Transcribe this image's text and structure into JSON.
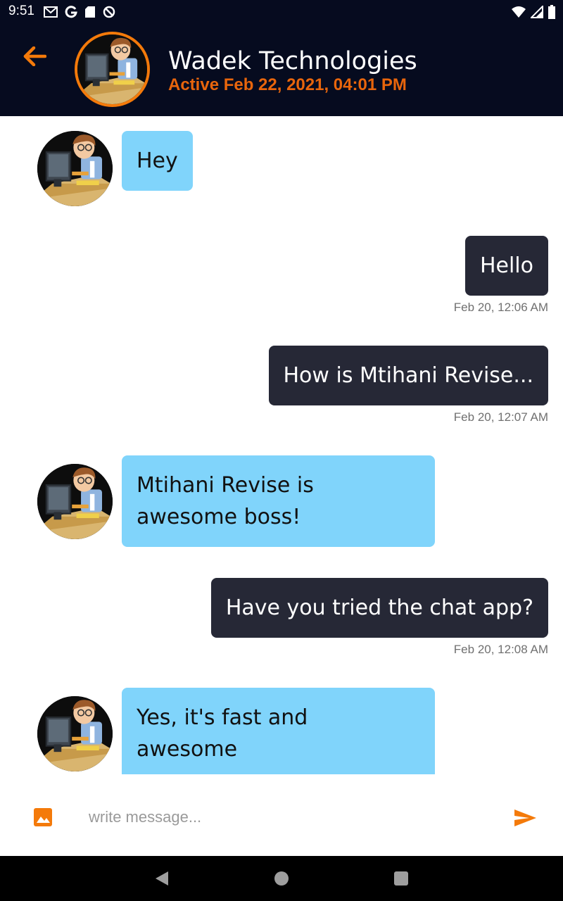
{
  "status_bar": {
    "time": "9:51",
    "left_icons": [
      "gmail-icon",
      "google-icon",
      "sd-card-icon",
      "no-disturb-icon"
    ],
    "right_icons": [
      "wifi-icon",
      "signal-icon",
      "battery-icon"
    ]
  },
  "header": {
    "back_icon": "arrow-back-icon",
    "contact_name": "Wadek Technologies",
    "status": "Active Feb 22, 2021, 04:01 PM"
  },
  "messages": [
    {
      "direction": "incoming",
      "text": "Hey"
    },
    {
      "direction": "outgoing",
      "text": "Hello",
      "time": "Feb 20, 12:06 AM"
    },
    {
      "direction": "outgoing",
      "text": "How is Mtihani Revise...",
      "time": "Feb 20, 12:07 AM"
    },
    {
      "direction": "incoming",
      "text_lines": [
        "Mtihani Revise is",
        "awesome boss!"
      ]
    },
    {
      "direction": "outgoing",
      "text": "Have you tried the chat app?",
      "time": "Feb 20, 12:08 AM"
    },
    {
      "direction": "incoming",
      "text_lines": [
        "Yes, it's fast and",
        "awesome"
      ]
    }
  ],
  "composer": {
    "placeholder": "write message...",
    "value": "",
    "attach_icon": "image-icon",
    "send_icon": "send-icon"
  },
  "colors": {
    "appbar": "#060b1f",
    "accent": "#f47a0a",
    "status_text": "#e8650c",
    "incoming_bubble": "#80d4fb",
    "outgoing_bubble": "#262836"
  }
}
